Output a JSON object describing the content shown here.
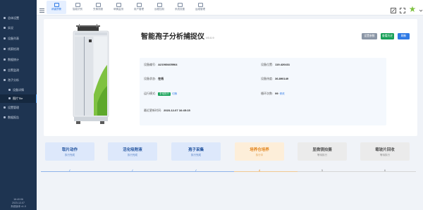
{
  "sidebar": {
    "items": [
      {
        "label": "总体设置"
      },
      {
        "label": "实况"
      },
      {
        "label": "设备列表"
      },
      {
        "label": "线索检测"
      },
      {
        "label": "数据统计"
      },
      {
        "label": "告警监测"
      },
      {
        "label": "孢子分析"
      },
      {
        "label": "设备详情"
      },
      {
        "label": "图片Tile"
      },
      {
        "label": "设置管理"
      },
      {
        "label": "数据报告"
      }
    ],
    "footer": {
      "time": "16:40:06",
      "date": "2023-12-07",
      "version": "系统版本 v1.0"
    }
  },
  "topbar": {
    "tabs": [
      {
        "label": "病害预警"
      },
      {
        "label": "智能识别"
      },
      {
        "label": "虫情测报"
      },
      {
        "label": "墒情监测"
      },
      {
        "label": "用户管理"
      },
      {
        "label": "远程控制"
      },
      {
        "label": "系统设置"
      },
      {
        "label": "运维管理"
      }
    ]
  },
  "device": {
    "title": "智能孢子分析捕捉仪",
    "version": "V0.0.9",
    "buttons": {
      "settings": "设置参数",
      "history": "查看历史",
      "refresh": "刷新"
    },
    "fields": {
      "serial_label": "设备编号:",
      "serial": "A21960405964",
      "location_label": "设备位置:",
      "location": "119.420431",
      "status_label": "设备状态:",
      "status": "在线",
      "latitude_label": "设备纬度:",
      "latitude": "36.890149",
      "mode_label": "运行模式:",
      "mode": "手动执行",
      "mode_link": "切换",
      "cycle_label": "循环次数:",
      "cycle": "99",
      "cycle_link": "修改",
      "updated_label": "最近更新时间:",
      "updated": "2023-12-07 16:45:15"
    }
  },
  "steps": [
    {
      "name": "取片动作",
      "sub": "执行完成",
      "state": "done"
    },
    {
      "name": "活化吸附液",
      "sub": "执行完成",
      "state": "done"
    },
    {
      "name": "孢子采集",
      "sub": "执行完成",
      "state": "done"
    },
    {
      "name": "培养仓培养",
      "sub": "执行中",
      "state": "current"
    },
    {
      "name": "显微镜拍摄",
      "sub": "等待执行",
      "state": "waiting"
    },
    {
      "name": "载玻片回收",
      "sub": "等待执行",
      "state": "waiting"
    }
  ],
  "progress_markers": [
    "✓",
    "✓",
    "✓",
    "4",
    "5",
    "6"
  ],
  "colors": {
    "sidebar": "#1e3451",
    "accent": "#2f7ae5",
    "done": "#dde8fb",
    "current": "#fdeed9",
    "waiting": "#ebebeb",
    "online": "#19a35a"
  }
}
